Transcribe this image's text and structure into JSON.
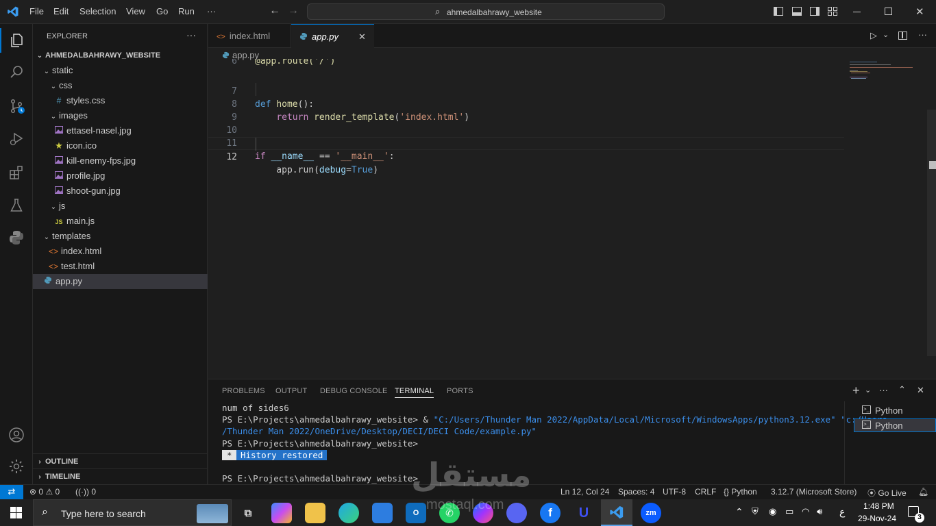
{
  "titlebar": {
    "menu": [
      "File",
      "Edit",
      "Selection",
      "View",
      "Go",
      "Run",
      "···"
    ],
    "search": "ahmedalbahrawy_website"
  },
  "explorer": {
    "title": "EXPLORER",
    "more": "···",
    "root": "AHMEDALBAHRAWY_WEBSITE",
    "tree": [
      {
        "label": "static",
        "type": "folder"
      },
      {
        "label": "css",
        "type": "folder"
      },
      {
        "label": "styles.css",
        "type": "css"
      },
      {
        "label": "images",
        "type": "folder"
      },
      {
        "label": "ettasel-nasel.jpg",
        "type": "img"
      },
      {
        "label": "icon.ico",
        "type": "ico"
      },
      {
        "label": "kill-enemy-fps.jpg",
        "type": "img"
      },
      {
        "label": "profile.jpg",
        "type": "img"
      },
      {
        "label": "shoot-gun.jpg",
        "type": "img"
      },
      {
        "label": "js",
        "type": "folder"
      },
      {
        "label": "main.js",
        "type": "js"
      },
      {
        "label": "templates",
        "type": "folder"
      },
      {
        "label": "index.html",
        "type": "html"
      },
      {
        "label": "test.html",
        "type": "html"
      },
      {
        "label": "app.py",
        "type": "py"
      }
    ],
    "outline": "OUTLINE",
    "timeline": "TIMELINE"
  },
  "tabs": [
    {
      "label": "index.html"
    },
    {
      "label": "app.py",
      "close": "✕"
    }
  ],
  "breadcrumb": "app.py",
  "code": {
    "line_numbers": [
      "6",
      "7",
      "8",
      "9",
      "10",
      "11",
      "12"
    ],
    "l6": [
      "@app.route('/')"
    ],
    "l7": [
      "def",
      " ",
      "home",
      "():"
    ],
    "l8": [
      "    ",
      "return",
      " ",
      "render_template",
      "(",
      "'index.html'",
      ")"
    ],
    "l11": [
      "if",
      " __name__ ",
      "==",
      " ",
      "'__main__'",
      ":"
    ],
    "l12": [
      "    app.run(",
      "debug",
      "=",
      "True",
      ")"
    ]
  },
  "panel": {
    "tabs": [
      "PROBLEMS",
      "OUTPUT",
      "DEBUG CONSOLE",
      "TERMINAL",
      "PORTS"
    ],
    "terminal": {
      "line1": "num of sides6",
      "line2_prompt": "PS E:\\Projects\\ahmedalbahrawy_website> & ",
      "line2_link": "\"C:/Users/Thunder Man 2022/AppData/Local/Microsoft/WindowsApps/python3.12.exe\" \"c:/Users",
      "line3_link": "/Thunder Man 2022/OneDrive/Desktop/DECI/DECI Code/example.py\"",
      "line4": "PS E:\\Projects\\ahmedalbahrawy_website>",
      "history_star": "*",
      "history": "History restored",
      "line6": "PS E:\\Projects\\ahmedalbahrawy_website> "
    },
    "instances": [
      "Python",
      "Python"
    ]
  },
  "status": {
    "errors": "0",
    "warnings": "0",
    "ports": "0",
    "position": "Ln 12, Col 24",
    "spaces": "Spaces: 4",
    "encoding": "UTF-8",
    "eol": "CRLF",
    "language": "Python",
    "interpreter": "3.12.7 (Microsoft Store)",
    "golive": "Go Live"
  },
  "taskbar": {
    "search_placeholder": "Type here to search",
    "time": "1:48 PM",
    "date": "29-Nov-24",
    "lang": "ع",
    "notif_count": "3"
  },
  "watermark": {
    "text": "مستقل",
    "sub": "mostaql.com"
  }
}
